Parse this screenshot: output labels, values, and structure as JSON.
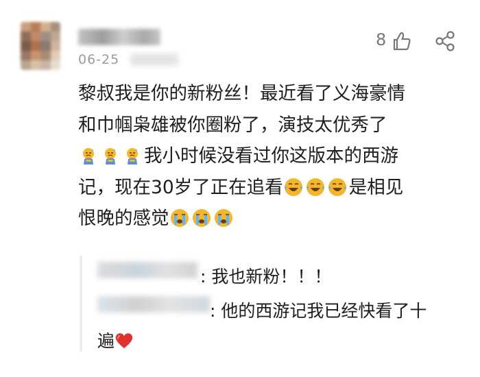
{
  "comment": {
    "date": "06-25",
    "likes": "8",
    "text_line1": "黎叔我是你的新粉丝！最近看了义海豪情",
    "text_line2": "和巾帼枭雄被你圈粉了，演技太优秀了",
    "text_line3": "我小时候没看过你这版本的西游",
    "text_line4a": "记，现在30岁了正在追看",
    "text_line4b": "是相见",
    "text_line5": "恨晚的感觉"
  },
  "replies": [
    {
      "text": ": 我也新粉！！！"
    },
    {
      "text": ": 他的西游记我已经快看了十",
      "continuation": "遍"
    }
  ],
  "icons": {
    "like": "thumbs-up-icon",
    "share": "share-icon",
    "emoji_sweat": "sweat-emoji-icon",
    "emoji_laugh_cry": "laugh-cry-emoji-icon",
    "emoji_cry": "crying-emoji-icon",
    "heart": "red-heart-icon"
  },
  "colors": {
    "meta_text": "#9b9b9b",
    "body_text": "#1d1d1d",
    "heart": "#e0322c",
    "emoji_yellow": "#f5b62a"
  }
}
